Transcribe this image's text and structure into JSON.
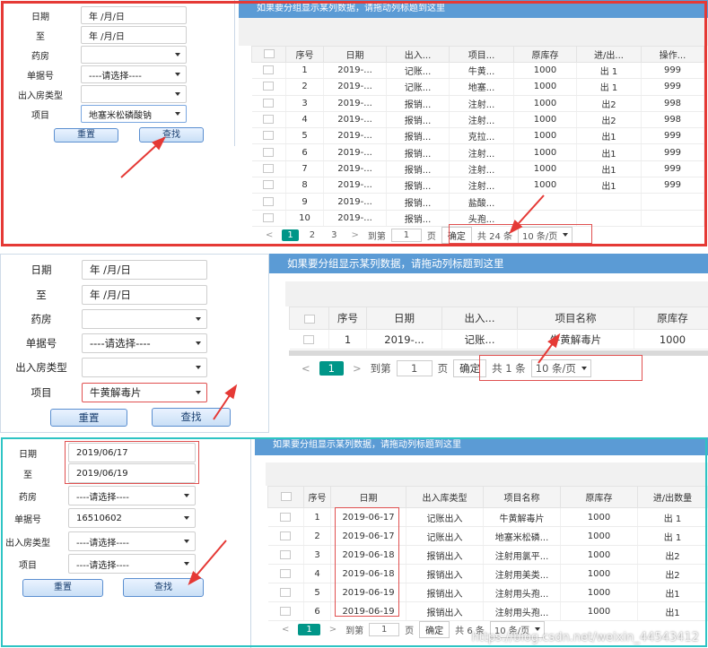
{
  "colors": {
    "panel1_frame": "#e53935",
    "panel3_frame": "#2ec4c4",
    "grid_header": "#5b9bd5",
    "pager_active": "#009688",
    "annotation": "#e53935"
  },
  "icons": {
    "select_caret": "caret-down-icon",
    "pager_prev": "chevron-left-icon",
    "pager_next": "chevron-right-icon",
    "row_checkbox": "checkbox-icon"
  },
  "panel1": {
    "form": {
      "date_label": "日期",
      "date_value": "年 /月/日",
      "to_label": "至",
      "to_value": "年 /月/日",
      "pharmacy_label": "药房",
      "pharmacy_value": "",
      "doc_label": "单据号",
      "doc_value": "----请选择----",
      "inout_label": "出入房类型",
      "inout_value": "",
      "item_label": "项目",
      "item_value": "地塞米松磷酸钠",
      "reset": "重置",
      "search": "查找"
    },
    "grid": {
      "header_text": "如果要分组显示某列数据，请拖动列标题到这里",
      "columns": [
        "序号",
        "日期",
        "出入...",
        "项目...",
        "原库存",
        "进/出...",
        "操作..."
      ],
      "rows": [
        [
          "1",
          "2019-...",
          "记账...",
          "牛黄...",
          "1000",
          "出 1",
          "999"
        ],
        [
          "2",
          "2019-...",
          "记账...",
          "地塞...",
          "1000",
          "出 1",
          "999"
        ],
        [
          "3",
          "2019-...",
          "报销...",
          "注射...",
          "1000",
          "出2",
          "998"
        ],
        [
          "4",
          "2019-...",
          "报销...",
          "注射...",
          "1000",
          "出2",
          "998"
        ],
        [
          "5",
          "2019-...",
          "报销...",
          "克拉...",
          "1000",
          "出1",
          "999"
        ],
        [
          "6",
          "2019-...",
          "报销...",
          "注射...",
          "1000",
          "出1",
          "999"
        ],
        [
          "7",
          "2019-...",
          "报销...",
          "注射...",
          "1000",
          "出1",
          "999"
        ],
        [
          "8",
          "2019-...",
          "报销...",
          "注射...",
          "1000",
          "出1",
          "999"
        ],
        [
          "9",
          "2019-...",
          "报销...",
          "盐酸...",
          "",
          "",
          ""
        ],
        [
          "10",
          "2019-...",
          "报销...",
          "头孢...",
          "",
          "",
          ""
        ]
      ]
    },
    "pager": {
      "pages": [
        "1",
        "2",
        "3"
      ],
      "goto_label": "到第",
      "page_input": "1",
      "page_unit": "页",
      "confirm": "确定",
      "total": "共 24 条",
      "size": "10 条/页"
    }
  },
  "panel2": {
    "form": {
      "date_label": "日期",
      "date_value": "年 /月/日",
      "to_label": "至",
      "to_value": "年 /月/日",
      "pharmacy_label": "药房",
      "pharmacy_value": "",
      "doc_label": "单据号",
      "doc_value": "----请选择----",
      "inout_label": "出入房类型",
      "inout_value": "",
      "item_label": "项目",
      "item_value": "牛黄解毒片",
      "reset": "重置",
      "search": "查找"
    },
    "grid": {
      "header_text": "如果要分组显示某列数据，请拖动列标题到这里",
      "columns": [
        "序号",
        "日期",
        "出入...",
        "项目名称",
        "原库存"
      ],
      "rows": [
        [
          "1",
          "2019-...",
          "记账...",
          "牛黄解毒片",
          "1000"
        ]
      ]
    },
    "pager": {
      "pages": [
        "1"
      ],
      "goto_label": "到第",
      "page_input": "1",
      "page_unit": "页",
      "confirm": "确定",
      "total": "共 1 条",
      "size": "10 条/页"
    }
  },
  "panel3": {
    "form": {
      "date_label": "日期",
      "date_value": "2019/06/17",
      "to_label": "至",
      "to_value": "2019/06/19",
      "pharmacy_label": "药房",
      "pharmacy_value": "----请选择----",
      "doc_label": "单据号",
      "doc_value": "16510602",
      "inout_label": "出入房类型",
      "inout_value": "----请选择----",
      "item_label": "项目",
      "item_value": "----请选择----",
      "reset": "重置",
      "search": "查找"
    },
    "grid": {
      "header_text": "如果要分组显示某列数据，请拖动列标题到这里",
      "columns": [
        "序号",
        "日期",
        "出入库类型",
        "项目名称",
        "原库存",
        "进/出数量"
      ],
      "rows": [
        [
          "1",
          "2019-06-17",
          "记账出入",
          "牛黄解毒片",
          "1000",
          "出 1"
        ],
        [
          "2",
          "2019-06-17",
          "记账出入",
          "地塞米松磷...",
          "1000",
          "出 1"
        ],
        [
          "3",
          "2019-06-18",
          "报销出入",
          "注射用氯平...",
          "1000",
          "出2"
        ],
        [
          "4",
          "2019-06-18",
          "报销出入",
          "注射用美类...",
          "1000",
          "出2"
        ],
        [
          "5",
          "2019-06-19",
          "报销出入",
          "注射用头孢...",
          "1000",
          "出1"
        ],
        [
          "6",
          "2019-06-19",
          "报销出入",
          "注射用头孢...",
          "1000",
          "出1"
        ]
      ]
    },
    "pager": {
      "pages": [
        "1"
      ],
      "goto_label": "到第",
      "page_input": "1",
      "page_unit": "页",
      "confirm": "确定",
      "total": "共 6 条",
      "size": "10 条/页"
    },
    "watermark": "https://blog.csdn.net/weixin_44543412"
  }
}
